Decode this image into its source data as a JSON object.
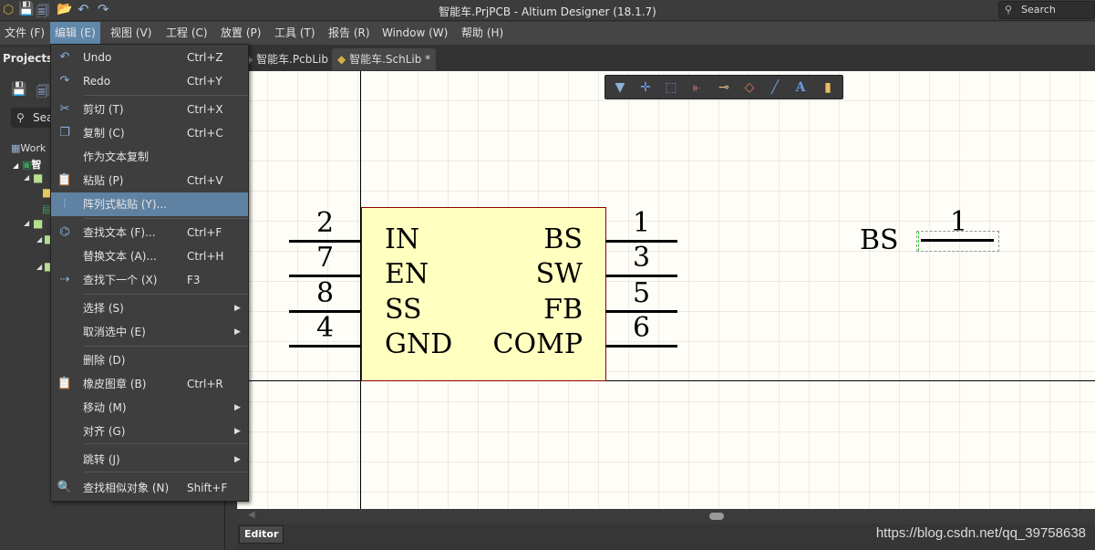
{
  "window": {
    "title": "智能车.PrjPCB - Altium Designer (18.1.7)",
    "search_placeholder": "Search"
  },
  "menubar": [
    {
      "label": "文件 (F)"
    },
    {
      "label": "编辑 (E)",
      "active": true
    },
    {
      "label": "视图 (V)"
    },
    {
      "label": "工程 (C)"
    },
    {
      "label": "放置 (P)"
    },
    {
      "label": "工具 (T)"
    },
    {
      "label": "报告 (R)"
    },
    {
      "label": "Window (W)"
    },
    {
      "label": "帮助 (H)"
    }
  ],
  "panel": {
    "title": "Projects",
    "search": "Sea",
    "tree": [
      "Work",
      "智"
    ]
  },
  "tabs": [
    {
      "label": "智能车.PcbLib"
    },
    {
      "label": "智能车.SchLib *",
      "active": true
    }
  ],
  "edit_menu": [
    {
      "label": "Undo",
      "shortcut": "Ctrl+Z",
      "icon": "undo-icon"
    },
    {
      "label": "Redo",
      "shortcut": "Ctrl+Y",
      "icon": "redo-icon"
    },
    {
      "label": "剪切 (T)",
      "shortcut": "Ctrl+X",
      "icon": "scissors-icon"
    },
    {
      "label": "复制 (C)",
      "shortcut": "Ctrl+C",
      "icon": "copy-icon"
    },
    {
      "label": "作为文本复制",
      "shortcut": ""
    },
    {
      "label": "粘贴 (P)",
      "shortcut": "Ctrl+V",
      "icon": "paste-icon"
    },
    {
      "label": "阵列式粘贴 (Y)...",
      "shortcut": "",
      "icon": "array-paste-icon",
      "highlighted": true
    },
    {
      "label": "查找文本 (F)...",
      "shortcut": "Ctrl+F",
      "icon": "binoculars-icon"
    },
    {
      "label": "替换文本 (A)...",
      "shortcut": "Ctrl+H"
    },
    {
      "label": "查找下一个 (X)",
      "shortcut": "F3",
      "icon": "find-next-icon"
    },
    {
      "label": "选择 (S)",
      "submenu": true
    },
    {
      "label": "取消选中 (E)",
      "submenu": true
    },
    {
      "label": "删除 (D)",
      "shortcut": ""
    },
    {
      "label": "橡皮图章 (B)",
      "shortcut": "Ctrl+R",
      "icon": "rubber-stamp-icon"
    },
    {
      "label": "移动 (M)",
      "submenu": true
    },
    {
      "label": "对齐 (G)",
      "submenu": true
    },
    {
      "label": "跳转 (J)",
      "submenu": true
    },
    {
      "label": "查找相似对象 (N)",
      "shortcut": "Shift+F",
      "icon": "magnifier-icon"
    }
  ],
  "component": {
    "left_pins": [
      {
        "num": "2",
        "name": "IN"
      },
      {
        "num": "7",
        "name": "EN"
      },
      {
        "num": "8",
        "name": "SS"
      },
      {
        "num": "4",
        "name": "GND"
      }
    ],
    "right_pins": [
      {
        "num": "1",
        "name": "BS"
      },
      {
        "num": "3",
        "name": "SW"
      },
      {
        "num": "5",
        "name": "FB"
      },
      {
        "num": "6",
        "name": "COMP"
      }
    ],
    "body_color": "#ffffc0",
    "border_color": "#8b0000"
  },
  "floating_pin": {
    "name": "BS",
    "num": "1"
  },
  "bottom": {
    "editor_tab": "Editor",
    "watermark": "https://blog.csdn.net/qq_39758638"
  }
}
